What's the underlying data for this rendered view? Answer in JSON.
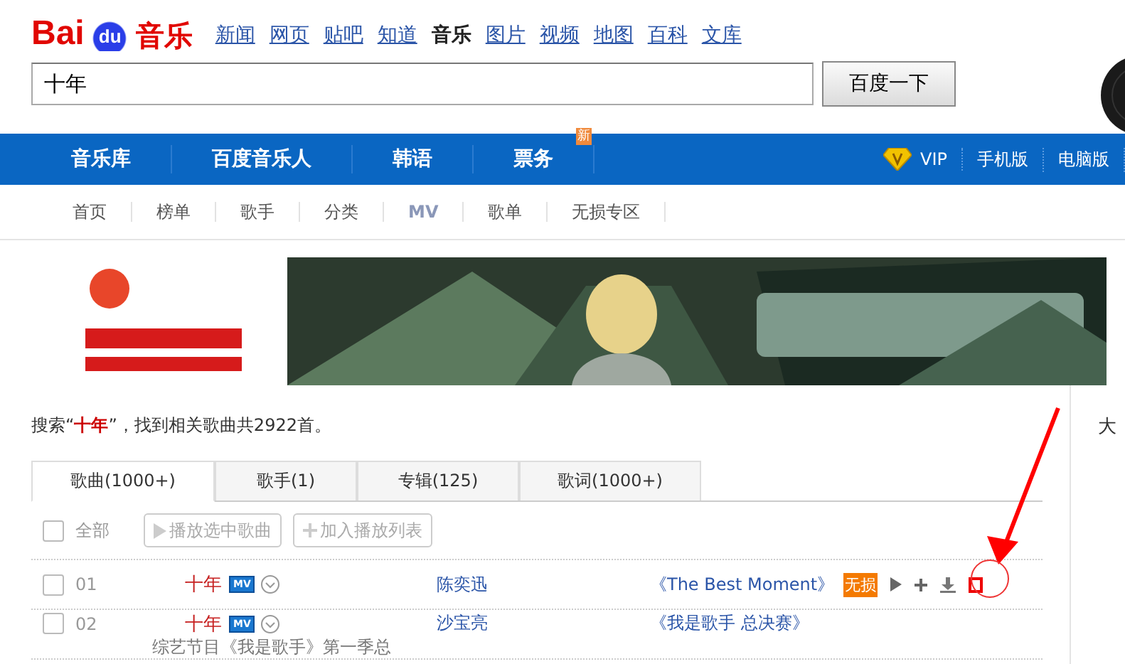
{
  "logo": {
    "part_1": "Bai",
    "part_2": "du",
    "part_3": "音乐"
  },
  "top_links": [
    {
      "label": "新闻",
      "selected": false
    },
    {
      "label": "网页",
      "selected": false
    },
    {
      "label": "贴吧",
      "selected": false
    },
    {
      "label": "知道",
      "selected": false
    },
    {
      "label": "音乐",
      "selected": true
    },
    {
      "label": "图片",
      "selected": false
    },
    {
      "label": "视频",
      "selected": false
    },
    {
      "label": "地图",
      "selected": false
    },
    {
      "label": "百科",
      "selected": false
    },
    {
      "label": "文库",
      "selected": false
    }
  ],
  "search": {
    "value": "十年",
    "button": "百度一下"
  },
  "main_nav": {
    "items": [
      {
        "label": "音乐库"
      },
      {
        "label": "百度音乐人"
      },
      {
        "label": "韩语"
      },
      {
        "label": "票务",
        "badge": "新"
      }
    ],
    "right": [
      {
        "label": "VIP",
        "kind": "vip"
      },
      {
        "label": "手机版",
        "kind": "plain"
      },
      {
        "label": "电脑版",
        "kind": "plain"
      }
    ]
  },
  "sub_nav": [
    {
      "label": "首页",
      "kind": "text"
    },
    {
      "label": "榜单",
      "kind": "text"
    },
    {
      "label": "歌手",
      "kind": "text"
    },
    {
      "label": "分类",
      "kind": "text"
    },
    {
      "label": "MV",
      "kind": "mv"
    },
    {
      "label": "歌单",
      "kind": "text"
    },
    {
      "label": "无损专区",
      "kind": "text"
    }
  ],
  "summary": "搜索“**十年**”，找到相关歌曲共2922首。",
  "tabs": [
    {
      "label": "歌曲(1000+)",
      "selected": true
    },
    {
      "label": "歌手(1)",
      "selected": false
    },
    {
      "label": "专辑(125)",
      "selected": false
    },
    {
      "label": "歌词(1000+)",
      "selected": false
    }
  ],
  "toolbar": {
    "select_all": {
      "label": "全部",
      "checked": false
    },
    "buttons": [
      {
        "label": "播放选中歌曲",
        "kind": "play"
      },
      {
        "label": "加入播放列表",
        "kind": "add"
      }
    ]
  },
  "songs": [
    {
      "index": "01",
      "checked": false,
      "title": "十年",
      "mv": "MV",
      "singer": "陈奕迅",
      "album": "《The Best Moment》",
      "badge": "无损",
      "actions": true
    },
    {
      "index": "02",
      "checked": false,
      "title": "十年",
      "mv": "MV",
      "singer": "沙宝亮",
      "album": "《我是歌手 总决赛》",
      "note": "综艺节目《我是歌手》第一季总",
      "actions": false
    }
  ],
  "sidebar": {
    "heading": "大"
  },
  "annotation": {
    "kind": "arrow-circle"
  }
}
